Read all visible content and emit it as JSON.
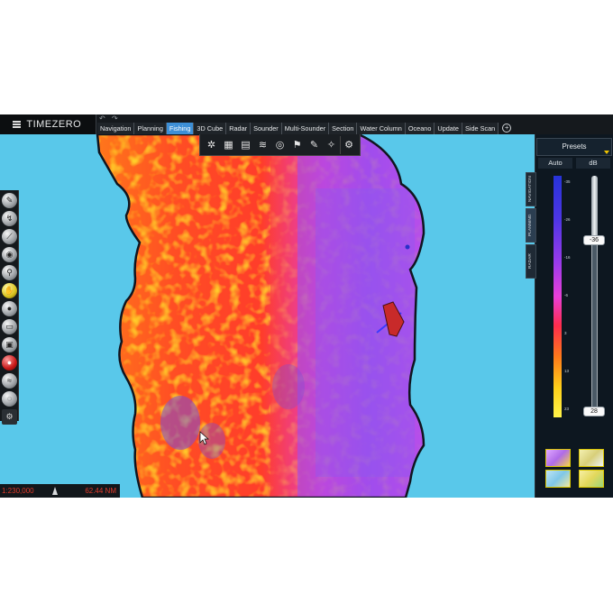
{
  "app": {
    "name": "TIMEZERO",
    "undo_label": "↶",
    "redo_label": "↷"
  },
  "tabs": [
    {
      "label": "Navigation",
      "active": false
    },
    {
      "label": "Planning",
      "active": false
    },
    {
      "label": "Fishing",
      "active": true
    },
    {
      "label": "3D Cube",
      "active": false
    },
    {
      "label": "Radar",
      "active": false
    },
    {
      "label": "Sounder",
      "active": false
    },
    {
      "label": "Multi-Sounder",
      "active": false
    },
    {
      "label": "Section",
      "active": false
    },
    {
      "label": "Water Column",
      "active": false
    },
    {
      "label": "Oceano",
      "active": false
    },
    {
      "label": "Update",
      "active": false
    },
    {
      "label": "Side Scan",
      "active": false
    }
  ],
  "fishing_toolbar": {
    "tools": [
      "compass-icon",
      "chart-book-icon",
      "layers-icon",
      "sonar-icon",
      "fish-finder-icon",
      "waypoint-icon",
      "brush-icon",
      "settings-icon"
    ]
  },
  "left_toolbar": {
    "tools": [
      "pen-icon",
      "route-icon",
      "measure-icon",
      "marker-icon",
      "zoom-icon",
      "mark-icon",
      "hand-icon",
      "circle-icon",
      "ruler-icon",
      "camera-icon",
      "record-icon",
      "sounder-icon",
      "ellipse-icon",
      "gear-icon"
    ]
  },
  "status": {
    "scale": "1:230,000",
    "range": "62.44 NM"
  },
  "right_panel": {
    "presets_label": "Presets",
    "mode_label": "Auto",
    "unit_label": "dB",
    "vertical_tabs": [
      "NAVIGATION",
      "PLANNING",
      "RADAR"
    ],
    "scale_labels": [
      "-35",
      "-26",
      "-16",
      "-6",
      "3",
      "13",
      "23"
    ],
    "slider_top_value": "-36",
    "slider_bottom_value": "28"
  },
  "colors": {
    "water": "#59c8ea",
    "ui_dark": "#15191d",
    "active_tab": "#3d8fd6",
    "status_text": "#e23b2a"
  }
}
